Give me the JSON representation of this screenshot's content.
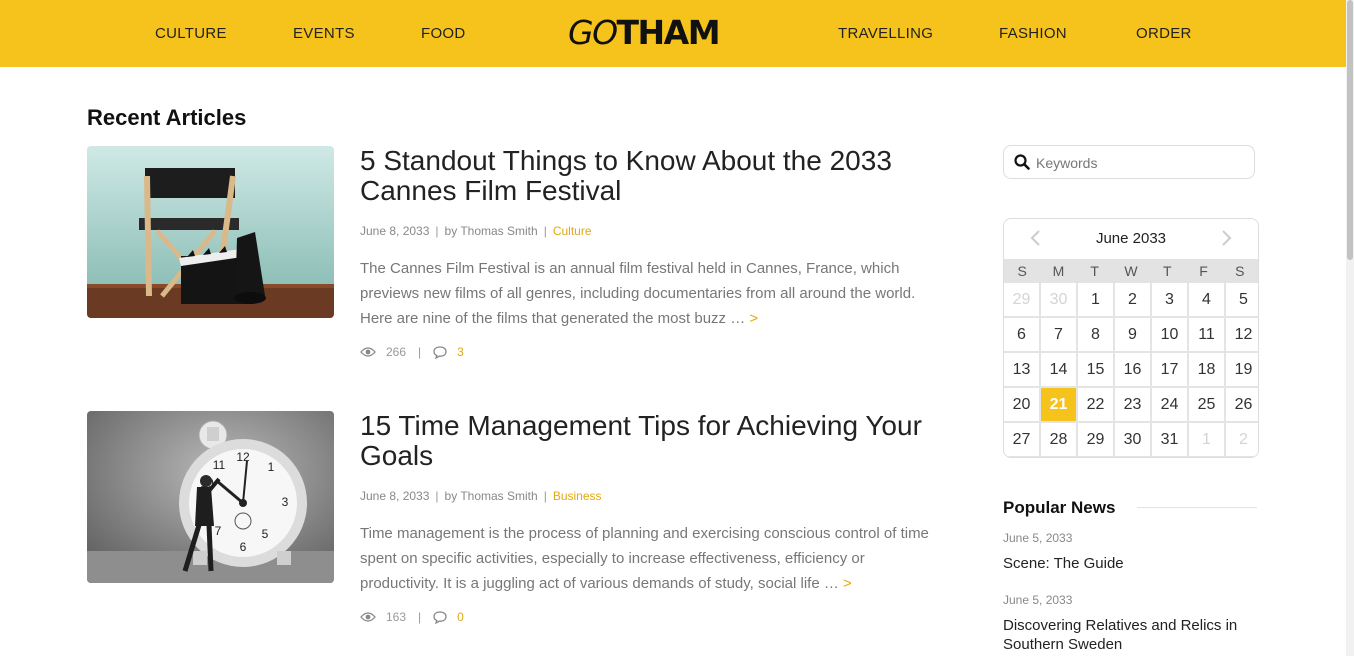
{
  "nav": {
    "left": [
      "CULTURE",
      "EVENTS",
      "FOOD"
    ],
    "right": [
      "TRAVELLING",
      "FASHION",
      "ORDER"
    ],
    "logo_go": "GO",
    "logo_rest": "THAM"
  },
  "colors": {
    "accent": "#f6c31c",
    "link": "#e0a812"
  },
  "main": {
    "section_title": "Recent Articles",
    "articles": [
      {
        "title": "5 Standout Things to Know About the 2033 Cannes Film Festival",
        "date": "June 8, 2033",
        "author": "by Thomas Smith",
        "category": "Culture",
        "excerpt": "The Cannes Film Festival is an annual film festival held in Cannes, France, which previews new films of all genres, including documentaries from all around the world. Here are nine of the films that generated the most buzz …",
        "more": ">",
        "views": "266",
        "comments": "3",
        "image_icon": "director-chair-clapperboard"
      },
      {
        "title": "15 Time Management Tips for Achieving Your Goals",
        "date": "June 8, 2033",
        "author": "by Thomas Smith",
        "category": "Business",
        "excerpt": "Time management is the process of planning and exercising conscious control of time spent on specific activities, especially to increase effectiveness, efficiency or productivity. It is a juggling act of various demands of study, social life …",
        "more": ">",
        "views": "163",
        "comments": "0",
        "image_icon": "alarm-clock-man"
      }
    ]
  },
  "sidebar": {
    "search_placeholder": "Keywords",
    "calendar": {
      "month": "June 2033",
      "weekdays": [
        "S",
        "M",
        "T",
        "W",
        "T",
        "F",
        "S"
      ],
      "days": [
        "29",
        "30",
        "1",
        "2",
        "3",
        "4",
        "5",
        "6",
        "7",
        "8",
        "9",
        "10",
        "11",
        "12",
        "13",
        "14",
        "15",
        "16",
        "17",
        "18",
        "19",
        "20",
        "21",
        "22",
        "23",
        "24",
        "25",
        "26",
        "27",
        "28",
        "29",
        "30",
        "31",
        "1",
        "2"
      ],
      "muted": [
        0,
        1,
        33,
        34
      ],
      "today_index": 22
    },
    "popular_title": "Popular News",
    "popular": [
      {
        "date": "June 5, 2033",
        "title": "Scene: The Guide"
      },
      {
        "date": "June 5, 2033",
        "title": "Discovering Relatives and Relics in Southern Sweden"
      }
    ]
  }
}
